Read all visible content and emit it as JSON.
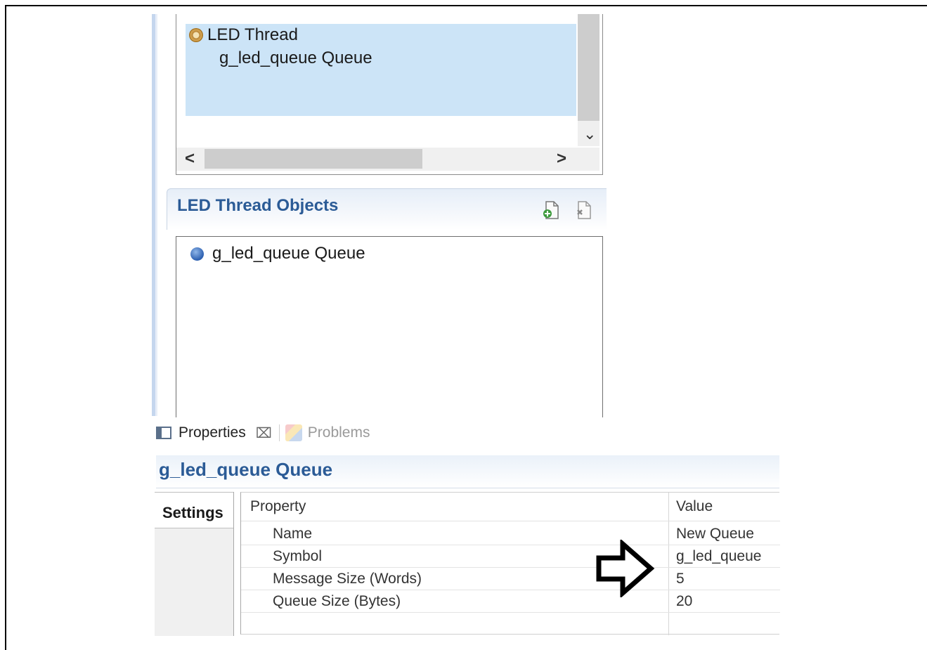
{
  "threads_tree": {
    "items": [
      {
        "label": "LED Thread",
        "icon": "gear-icon",
        "children": [
          {
            "label": "g_led_queue Queue"
          }
        ]
      }
    ]
  },
  "objects_section": {
    "title": "LED Thread Objects",
    "items": [
      {
        "label": "g_led_queue Queue",
        "icon": "blue-dot-icon"
      }
    ]
  },
  "tabs": {
    "properties": "Properties",
    "close_symbol": "⌧",
    "problems": "Problems"
  },
  "properties": {
    "title": "g_led_queue Queue",
    "side_tab": "Settings",
    "columns": {
      "property": "Property",
      "value": "Value"
    },
    "rows": [
      {
        "property": "Name",
        "value": "New Queue"
      },
      {
        "property": "Symbol",
        "value": "g_led_queue"
      },
      {
        "property": "Message Size (Words)",
        "value": "5"
      },
      {
        "property": "Queue Size (Bytes)",
        "value": "20"
      }
    ]
  },
  "colors": {
    "selection": "#cce4f7",
    "header_text": "#2b5b96"
  }
}
